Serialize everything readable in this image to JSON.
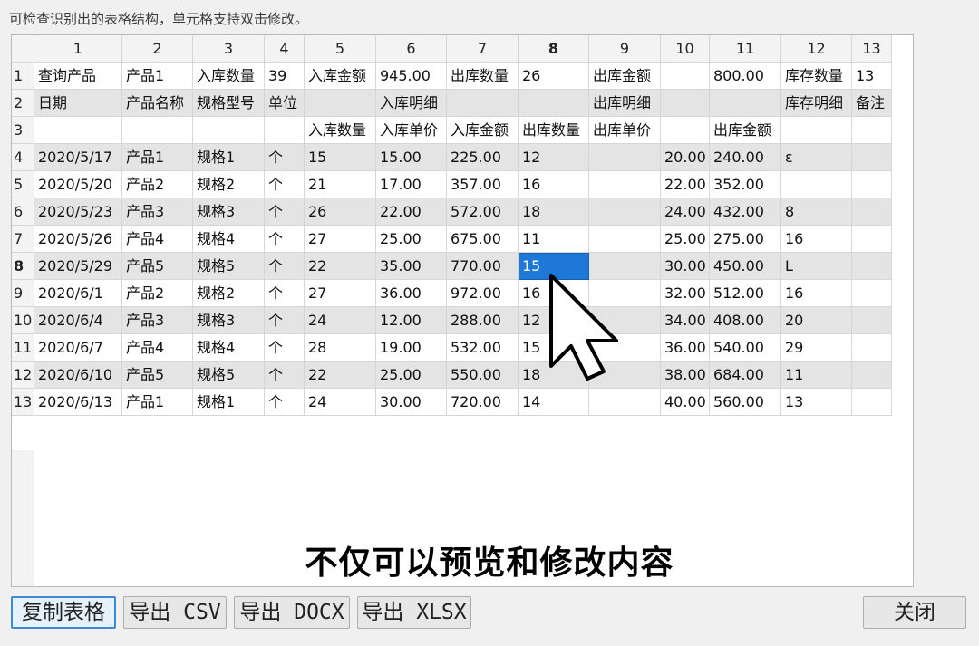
{
  "hint": "可检查识别出的表格结构，单元格支持双击修改。",
  "column_headers": [
    "1",
    "2",
    "3",
    "4",
    "5",
    "6",
    "7",
    "8",
    "9",
    "10",
    "11",
    "12",
    "13"
  ],
  "selected_column": "8",
  "row_headers": [
    "1",
    "2",
    "3",
    "4",
    "5",
    "6",
    "7",
    "8",
    "9",
    "10",
    "11",
    "12",
    "13"
  ],
  "selected_row": "8",
  "rows": [
    [
      "查询产品",
      "产品1",
      "入库数量",
      "39",
      "入库金额",
      "945.00",
      "出库数量",
      "26",
      "出库金额",
      "",
      "800.00",
      "库存数量",
      "13"
    ],
    [
      "日期",
      "产品名称",
      "规格型号",
      "单位",
      "",
      "入库明细",
      "",
      "",
      "出库明细",
      "",
      "",
      "库存明细",
      "备注"
    ],
    [
      "",
      "",
      "",
      "",
      "入库数量",
      "入库单价",
      "入库金额",
      "出库数量",
      "出库单价",
      "",
      "出库金额",
      "",
      ""
    ],
    [
      "2020/5/17",
      "产品1",
      "规格1",
      "个",
      "15",
      "15.00",
      "225.00",
      "12",
      "",
      "20.00",
      "240.00",
      "ε",
      ""
    ],
    [
      "2020/5/20",
      "产品2",
      "规格2",
      "个",
      "21",
      "17.00",
      "357.00",
      "16",
      "",
      "22.00",
      "352.00",
      "",
      ""
    ],
    [
      "2020/5/23",
      "产品3",
      "规格3",
      "个",
      "26",
      "22.00",
      "572.00",
      "18",
      "",
      "24.00",
      "432.00",
      "8",
      ""
    ],
    [
      "2020/5/26",
      "产品4",
      "规格4",
      "个",
      "27",
      "25.00",
      "675.00",
      "11",
      "",
      "25.00",
      "275.00",
      "16",
      ""
    ],
    [
      "2020/5/29",
      "产品5",
      "规格5",
      "个",
      "22",
      "35.00",
      "770.00",
      "15",
      "",
      "30.00",
      "450.00",
      "L",
      ""
    ],
    [
      "2020/6/1",
      "产品2",
      "规格2",
      "个",
      "27",
      "36.00",
      "972.00",
      "16",
      "",
      "32.00",
      "512.00",
      "16",
      ""
    ],
    [
      "2020/6/4",
      "产品3",
      "规格3",
      "个",
      "24",
      "12.00",
      "288.00",
      "12",
      "",
      "34.00",
      "408.00",
      "20",
      ""
    ],
    [
      "2020/6/7",
      "产品4",
      "规格4",
      "个",
      "28",
      "19.00",
      "532.00",
      "15",
      "",
      "36.00",
      "540.00",
      "29",
      ""
    ],
    [
      "2020/6/10",
      "产品5",
      "规格5",
      "个",
      "22",
      "25.00",
      "550.00",
      "18",
      "",
      "38.00",
      "684.00",
      "11",
      ""
    ],
    [
      "2020/6/13",
      "产品1",
      "规格1",
      "个",
      "24",
      "30.00",
      "720.00",
      "14",
      "",
      "40.00",
      "560.00",
      "13",
      ""
    ]
  ],
  "subtitle": "不仅可以预览和修改内容",
  "buttons": {
    "copy": "复制表格",
    "csv": "导出 CSV",
    "docx": "导出 DOCX",
    "xlsx": "导出 XLSX",
    "close": "关闭"
  },
  "colors": {
    "selection": "#1e78d7",
    "shaded_row": "#e4e4e4"
  }
}
